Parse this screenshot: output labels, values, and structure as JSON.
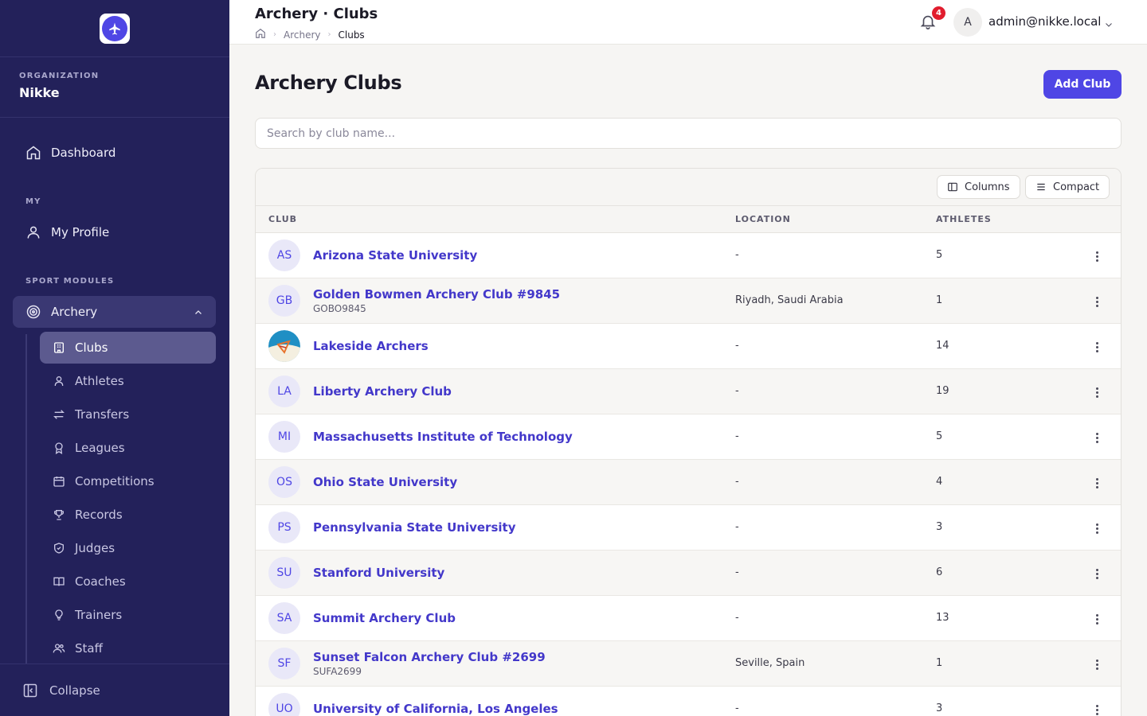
{
  "sidebar": {
    "org_label": "ORGANIZATION",
    "org_name": "Nikke",
    "dashboard": "Dashboard",
    "my_label": "MY",
    "my_profile": "My Profile",
    "sport_label": "SPORT MODULES",
    "archery": "Archery",
    "sub_items": [
      {
        "label": "Clubs",
        "icon": "building-icon"
      },
      {
        "label": "Athletes",
        "icon": "user-icon"
      },
      {
        "label": "Transfers",
        "icon": "arrows-icon"
      },
      {
        "label": "Leagues",
        "icon": "medal-icon"
      },
      {
        "label": "Competitions",
        "icon": "calendar-icon"
      },
      {
        "label": "Records",
        "icon": "trophy-icon"
      },
      {
        "label": "Judges",
        "icon": "shield-icon"
      },
      {
        "label": "Coaches",
        "icon": "book-icon"
      },
      {
        "label": "Trainers",
        "icon": "lightbulb-icon"
      },
      {
        "label": "Staff",
        "icon": "users-icon"
      }
    ],
    "collapse": "Collapse"
  },
  "header": {
    "title": "Archery · Clubs",
    "breadcrumb": [
      "Archery",
      "Clubs"
    ],
    "notifications": "4",
    "avatar_initial": "A",
    "user_email": "admin@nikke.local"
  },
  "main": {
    "title": "Archery Clubs",
    "add_button": "Add Club",
    "search_placeholder": "Search by club name...",
    "toolbar": {
      "columns": "Columns",
      "compact": "Compact"
    },
    "columns": [
      "CLUB",
      "LOCATION",
      "ATHLETES"
    ],
    "rows": [
      {
        "initials": "AS",
        "name": "Arizona State University",
        "code": "",
        "location": "-",
        "athletes": "5"
      },
      {
        "initials": "GB",
        "name": "Golden Bowmen Archery Club #9845",
        "code": "GOBO9845",
        "location": "Riyadh, Saudi Arabia",
        "athletes": "1"
      },
      {
        "initials": "",
        "name": "Lakeside Archers",
        "code": "",
        "location": "-",
        "athletes": "14"
      },
      {
        "initials": "LA",
        "name": "Liberty Archery Club",
        "code": "",
        "location": "-",
        "athletes": "19"
      },
      {
        "initials": "MI",
        "name": "Massachusetts Institute of Technology",
        "code": "",
        "location": "-",
        "athletes": "5"
      },
      {
        "initials": "OS",
        "name": "Ohio State University",
        "code": "",
        "location": "-",
        "athletes": "4"
      },
      {
        "initials": "PS",
        "name": "Pennsylvania State University",
        "code": "",
        "location": "-",
        "athletes": "3"
      },
      {
        "initials": "SU",
        "name": "Stanford University",
        "code": "",
        "location": "-",
        "athletes": "6"
      },
      {
        "initials": "SA",
        "name": "Summit Archery Club",
        "code": "",
        "location": "-",
        "athletes": "13"
      },
      {
        "initials": "SF",
        "name": "Sunset Falcon Archery Club #2699",
        "code": "SUFA2699",
        "location": "Seville, Spain",
        "athletes": "1"
      },
      {
        "initials": "UO",
        "name": "University of California, Los Angeles",
        "code": "",
        "location": "-",
        "athletes": "3"
      }
    ]
  },
  "colors": {
    "sidebar_bg": "#23215a",
    "accent": "#4f46e5",
    "badge": "#e11d2e"
  }
}
